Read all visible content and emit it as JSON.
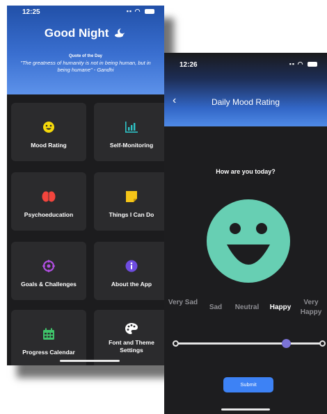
{
  "home": {
    "status": {
      "time": "12:25"
    },
    "greeting": "Good Night",
    "quote_title": "Quote of the Day",
    "quote_text": "\"The greatness of humanity is not in being human, but in being humane\" - Gandhi",
    "tiles": [
      {
        "label": "Mood Rating",
        "icon": "smiley-face-icon",
        "color": "#f5d90a"
      },
      {
        "label": "Self-Monitoring",
        "icon": "bar-chart-icon",
        "color": "#2ec4c7"
      },
      {
        "label": "Psychoeducation",
        "icon": "brain-icon",
        "color": "#f2453d"
      },
      {
        "label": "Things I Can Do",
        "icon": "sticky-note-icon",
        "color": "#f5c518"
      },
      {
        "label": "Goals & Challenges",
        "icon": "target-icon",
        "color": "#b04fe0"
      },
      {
        "label": "About the App",
        "icon": "info-icon",
        "color": "#6e4ce0"
      },
      {
        "label": "Progress Calendar",
        "icon": "calendar-icon",
        "color": "#3fc46a"
      },
      {
        "label": "Font and Theme Settings",
        "icon": "palette-icon",
        "color": "#ffffff"
      }
    ]
  },
  "mood": {
    "status": {
      "time": "12:26"
    },
    "title": "Daily Mood Rating",
    "question": "How are you today?",
    "face_color": "#67cfb3",
    "labels": [
      "Very Sad",
      "Sad",
      "Neutral",
      "Happy",
      "Very Happy"
    ],
    "selected_index": 3,
    "slider_value": 0.75,
    "submit_label": "Submit",
    "accent": "#3d82f5"
  }
}
